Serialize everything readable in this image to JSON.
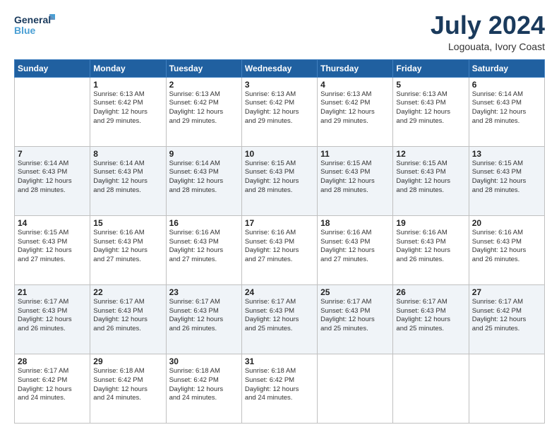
{
  "logo": {
    "line1": "General",
    "line2": "Blue"
  },
  "header": {
    "title": "July 2024",
    "location": "Logouata, Ivory Coast"
  },
  "weekdays": [
    "Sunday",
    "Monday",
    "Tuesday",
    "Wednesday",
    "Thursday",
    "Friday",
    "Saturday"
  ],
  "weeks": [
    [
      {
        "day": "",
        "info": ""
      },
      {
        "day": "1",
        "info": "Sunrise: 6:13 AM\nSunset: 6:42 PM\nDaylight: 12 hours\nand 29 minutes."
      },
      {
        "day": "2",
        "info": "Sunrise: 6:13 AM\nSunset: 6:42 PM\nDaylight: 12 hours\nand 29 minutes."
      },
      {
        "day": "3",
        "info": "Sunrise: 6:13 AM\nSunset: 6:42 PM\nDaylight: 12 hours\nand 29 minutes."
      },
      {
        "day": "4",
        "info": "Sunrise: 6:13 AM\nSunset: 6:42 PM\nDaylight: 12 hours\nand 29 minutes."
      },
      {
        "day": "5",
        "info": "Sunrise: 6:13 AM\nSunset: 6:43 PM\nDaylight: 12 hours\nand 29 minutes."
      },
      {
        "day": "6",
        "info": "Sunrise: 6:14 AM\nSunset: 6:43 PM\nDaylight: 12 hours\nand 28 minutes."
      }
    ],
    [
      {
        "day": "7",
        "info": "Sunrise: 6:14 AM\nSunset: 6:43 PM\nDaylight: 12 hours\nand 28 minutes."
      },
      {
        "day": "8",
        "info": "Sunrise: 6:14 AM\nSunset: 6:43 PM\nDaylight: 12 hours\nand 28 minutes."
      },
      {
        "day": "9",
        "info": "Sunrise: 6:14 AM\nSunset: 6:43 PM\nDaylight: 12 hours\nand 28 minutes."
      },
      {
        "day": "10",
        "info": "Sunrise: 6:15 AM\nSunset: 6:43 PM\nDaylight: 12 hours\nand 28 minutes."
      },
      {
        "day": "11",
        "info": "Sunrise: 6:15 AM\nSunset: 6:43 PM\nDaylight: 12 hours\nand 28 minutes."
      },
      {
        "day": "12",
        "info": "Sunrise: 6:15 AM\nSunset: 6:43 PM\nDaylight: 12 hours\nand 28 minutes."
      },
      {
        "day": "13",
        "info": "Sunrise: 6:15 AM\nSunset: 6:43 PM\nDaylight: 12 hours\nand 28 minutes."
      }
    ],
    [
      {
        "day": "14",
        "info": "Sunrise: 6:15 AM\nSunset: 6:43 PM\nDaylight: 12 hours\nand 27 minutes."
      },
      {
        "day": "15",
        "info": "Sunrise: 6:16 AM\nSunset: 6:43 PM\nDaylight: 12 hours\nand 27 minutes."
      },
      {
        "day": "16",
        "info": "Sunrise: 6:16 AM\nSunset: 6:43 PM\nDaylight: 12 hours\nand 27 minutes."
      },
      {
        "day": "17",
        "info": "Sunrise: 6:16 AM\nSunset: 6:43 PM\nDaylight: 12 hours\nand 27 minutes."
      },
      {
        "day": "18",
        "info": "Sunrise: 6:16 AM\nSunset: 6:43 PM\nDaylight: 12 hours\nand 27 minutes."
      },
      {
        "day": "19",
        "info": "Sunrise: 6:16 AM\nSunset: 6:43 PM\nDaylight: 12 hours\nand 26 minutes."
      },
      {
        "day": "20",
        "info": "Sunrise: 6:16 AM\nSunset: 6:43 PM\nDaylight: 12 hours\nand 26 minutes."
      }
    ],
    [
      {
        "day": "21",
        "info": "Sunrise: 6:17 AM\nSunset: 6:43 PM\nDaylight: 12 hours\nand 26 minutes."
      },
      {
        "day": "22",
        "info": "Sunrise: 6:17 AM\nSunset: 6:43 PM\nDaylight: 12 hours\nand 26 minutes."
      },
      {
        "day": "23",
        "info": "Sunrise: 6:17 AM\nSunset: 6:43 PM\nDaylight: 12 hours\nand 26 minutes."
      },
      {
        "day": "24",
        "info": "Sunrise: 6:17 AM\nSunset: 6:43 PM\nDaylight: 12 hours\nand 25 minutes."
      },
      {
        "day": "25",
        "info": "Sunrise: 6:17 AM\nSunset: 6:43 PM\nDaylight: 12 hours\nand 25 minutes."
      },
      {
        "day": "26",
        "info": "Sunrise: 6:17 AM\nSunset: 6:43 PM\nDaylight: 12 hours\nand 25 minutes."
      },
      {
        "day": "27",
        "info": "Sunrise: 6:17 AM\nSunset: 6:42 PM\nDaylight: 12 hours\nand 25 minutes."
      }
    ],
    [
      {
        "day": "28",
        "info": "Sunrise: 6:17 AM\nSunset: 6:42 PM\nDaylight: 12 hours\nand 24 minutes."
      },
      {
        "day": "29",
        "info": "Sunrise: 6:18 AM\nSunset: 6:42 PM\nDaylight: 12 hours\nand 24 minutes."
      },
      {
        "day": "30",
        "info": "Sunrise: 6:18 AM\nSunset: 6:42 PM\nDaylight: 12 hours\nand 24 minutes."
      },
      {
        "day": "31",
        "info": "Sunrise: 6:18 AM\nSunset: 6:42 PM\nDaylight: 12 hours\nand 24 minutes."
      },
      {
        "day": "",
        "info": ""
      },
      {
        "day": "",
        "info": ""
      },
      {
        "day": "",
        "info": ""
      }
    ]
  ]
}
